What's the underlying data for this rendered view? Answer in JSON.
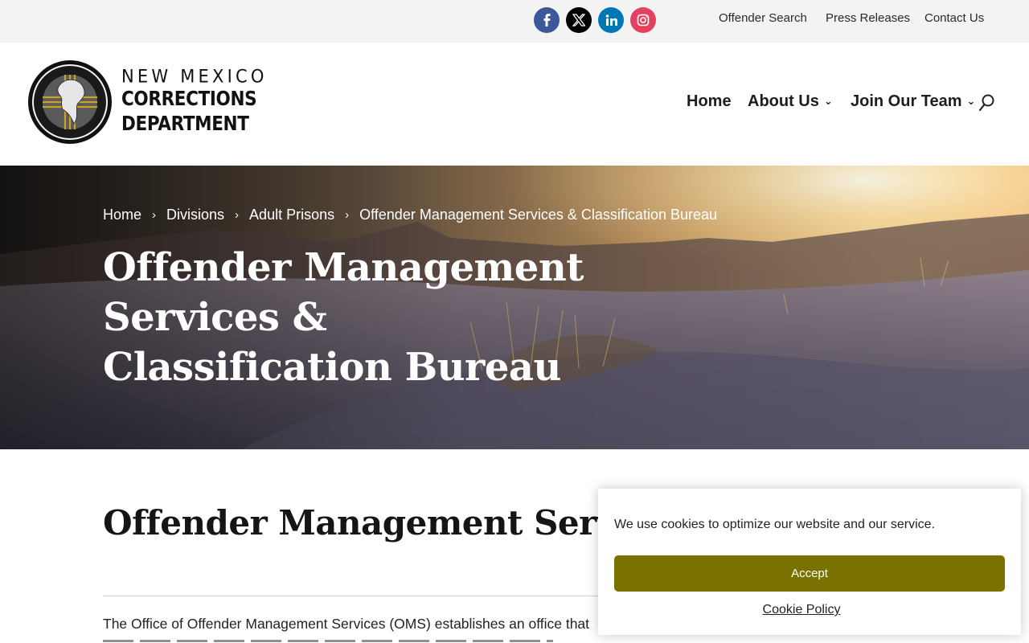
{
  "topbar": {
    "social": [
      {
        "name": "facebook-icon",
        "color": "#3b5998"
      },
      {
        "name": "x-icon",
        "color": "#000000"
      },
      {
        "name": "linkedin-icon",
        "color": "#0077b5"
      },
      {
        "name": "instagram-icon",
        "color": "#e4405f"
      }
    ],
    "links": {
      "offender_search": "Offender Search",
      "press_releases": "Press Releases",
      "contact_us": "Contact Us"
    }
  },
  "logo": {
    "line1": "NEW MEXICO",
    "line2": "CORRECTIONS",
    "line3": "DEPARTMENT"
  },
  "nav": {
    "home": "Home",
    "about": "About Us",
    "join": "Join Our Team",
    "search_icon": "search-icon"
  },
  "hero": {
    "breadcrumb": [
      "Home",
      "Divisions",
      "Adult Prisons",
      "Offender Management Services & Classification Bureau"
    ],
    "title_line1": "Offender Management Services &",
    "title_line2": "Classification Bureau"
  },
  "content": {
    "heading": "Offender Management Services",
    "paragraph": "The Office of Offender Management Services (OMS) establishes an office that"
  },
  "cookie": {
    "message": "We use cookies to optimize our website and our service.",
    "accept": "Accept",
    "policy": "Cookie Policy",
    "accent_color": "#7a7200"
  }
}
